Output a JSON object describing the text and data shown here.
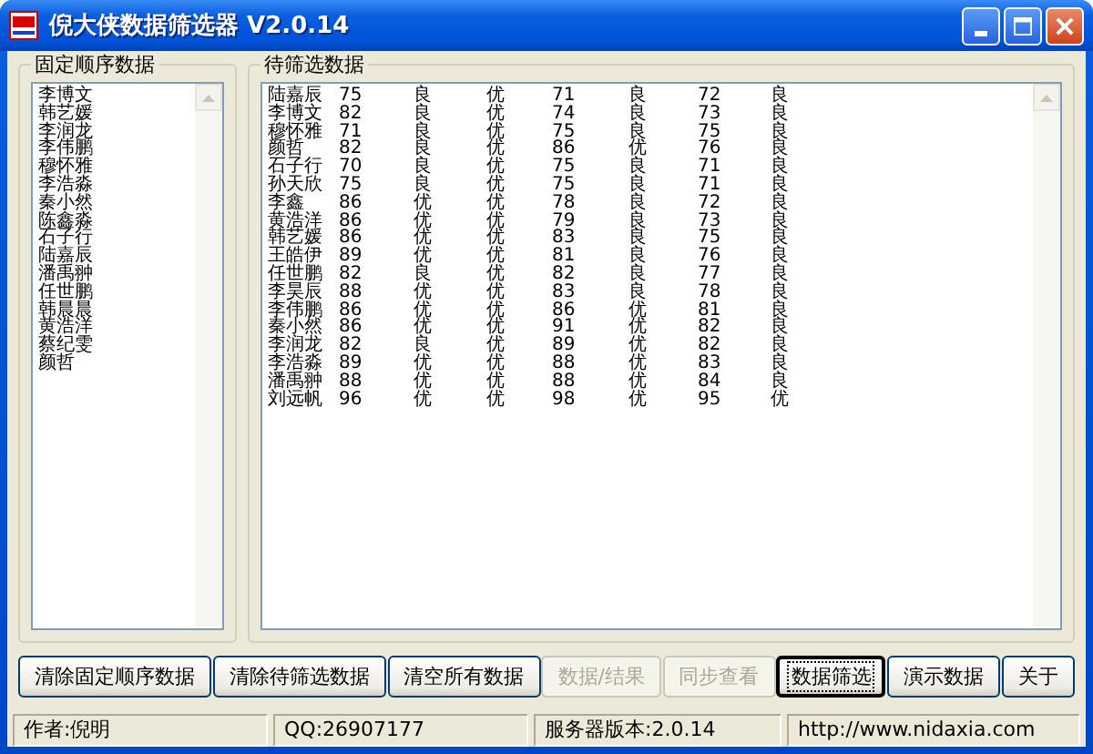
{
  "window": {
    "title": "倪大侠数据筛选器 V2.0.14"
  },
  "fixed_list": {
    "title": "固定顺序数据",
    "items": [
      "李博文",
      "韩艺媛",
      "李润龙",
      "李伟鹏",
      "穆怀雅",
      "李浩淼",
      "秦小然",
      "陈鑫淼",
      "石子行",
      "陆嘉辰",
      "潘禹翀",
      "任世鹏",
      "韩晨晨",
      "黄浩洋",
      "蔡纪雯",
      "颜哲"
    ]
  },
  "filter_list": {
    "title": "待筛选数据",
    "rows": [
      [
        "陆嘉辰",
        "75",
        "良",
        "优",
        "71",
        "良",
        "72",
        "良"
      ],
      [
        "李博文",
        "82",
        "良",
        "优",
        "74",
        "良",
        "73",
        "良"
      ],
      [
        "穆怀雅",
        "71",
        "良",
        "优",
        "75",
        "良",
        "75",
        "良"
      ],
      [
        "颜哲",
        "82",
        "良",
        "优",
        "86",
        "优",
        "76",
        "良"
      ],
      [
        "石子行",
        "70",
        "良",
        "优",
        "75",
        "良",
        "71",
        "良"
      ],
      [
        "孙天欣",
        "75",
        "良",
        "优",
        "75",
        "良",
        "71",
        "良"
      ],
      [
        "李鑫",
        "86",
        "优",
        "优",
        "78",
        "良",
        "72",
        "良"
      ],
      [
        "黄浩洋",
        "86",
        "优",
        "优",
        "79",
        "良",
        "73",
        "良"
      ],
      [
        "韩艺媛",
        "86",
        "优",
        "优",
        "83",
        "良",
        "75",
        "良"
      ],
      [
        "王皓伊",
        "89",
        "优",
        "优",
        "81",
        "良",
        "76",
        "良"
      ],
      [
        "任世鹏",
        "82",
        "良",
        "优",
        "82",
        "良",
        "77",
        "良"
      ],
      [
        "李昊辰",
        "88",
        "优",
        "优",
        "83",
        "良",
        "78",
        "良"
      ],
      [
        "李伟鹏",
        "86",
        "优",
        "优",
        "86",
        "优",
        "81",
        "良"
      ],
      [
        "秦小然",
        "86",
        "优",
        "优",
        "91",
        "优",
        "82",
        "良"
      ],
      [
        "李润龙",
        "82",
        "良",
        "优",
        "89",
        "优",
        "82",
        "良"
      ],
      [
        "李浩淼",
        "89",
        "优",
        "优",
        "88",
        "优",
        "83",
        "良"
      ],
      [
        "潘禹翀",
        "88",
        "优",
        "优",
        "88",
        "优",
        "84",
        "良"
      ],
      [
        "刘远帆",
        "96",
        "优",
        "优",
        "98",
        "优",
        "95",
        "优"
      ]
    ]
  },
  "buttons": [
    {
      "label": "清除固定顺序数据",
      "disabled": false,
      "focused": false
    },
    {
      "label": "清除待筛选数据",
      "disabled": false,
      "focused": false
    },
    {
      "label": "清空所有数据",
      "disabled": false,
      "focused": false
    },
    {
      "label": "数据/结果",
      "disabled": true,
      "focused": false
    },
    {
      "label": "同步查看",
      "disabled": true,
      "focused": false
    },
    {
      "label": "数据筛选",
      "disabled": false,
      "focused": true
    },
    {
      "label": "演示数据",
      "disabled": false,
      "focused": false
    },
    {
      "label": "关于",
      "disabled": false,
      "focused": false
    }
  ],
  "status_bar": [
    "作者:倪明",
    "QQ:26907177",
    "服务器版本:2.0.14",
    "http://www.nidaxia.com"
  ]
}
